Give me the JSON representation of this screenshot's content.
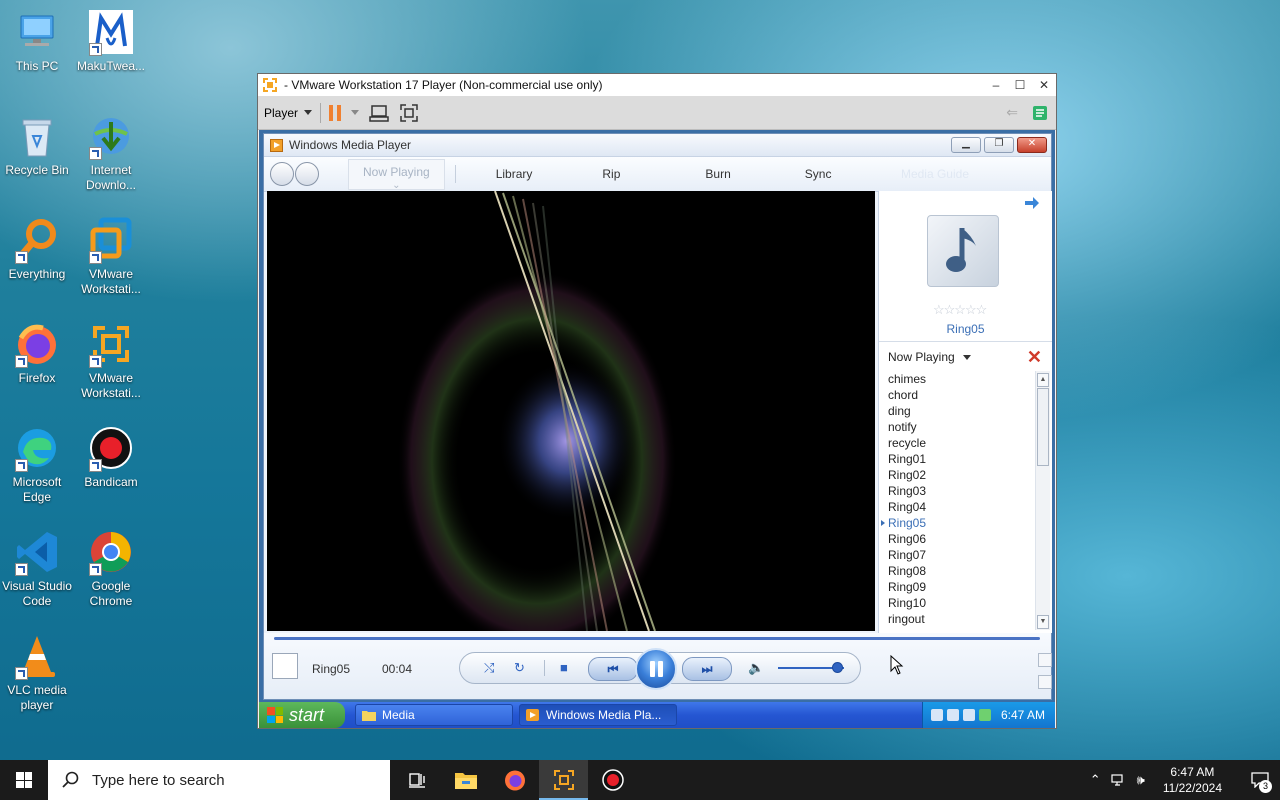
{
  "desktop": {
    "icons": [
      {
        "label": "This PC",
        "icon": "this-pc-icon"
      },
      {
        "label": "MakuTwea...",
        "icon": "makutweaker-icon"
      },
      {
        "label": "Recycle Bin",
        "icon": "recycle-bin-icon"
      },
      {
        "label": "Internet Downlo...",
        "icon": "internet-download-manager-icon"
      },
      {
        "label": "Everything",
        "icon": "everything-search-icon"
      },
      {
        "label": "VMware Workstati...",
        "icon": "vmware-workstation-icon"
      },
      {
        "label": "Firefox",
        "icon": "firefox-icon"
      },
      {
        "label": "VMware Workstati...",
        "icon": "vmware-workstation-player-icon"
      },
      {
        "label": "Microsoft Edge",
        "icon": "edge-icon"
      },
      {
        "label": "Bandicam",
        "icon": "bandicam-icon"
      },
      {
        "label": "Visual Studio Code",
        "icon": "vscode-icon"
      },
      {
        "label": "Google Chrome",
        "icon": "chrome-icon"
      },
      {
        "label": "VLC media player",
        "icon": "vlc-icon"
      }
    ]
  },
  "vmware": {
    "title": "- VMware Workstation 17 Player (Non-commercial use only)",
    "player_menu": "Player",
    "controls": {
      "minimize": "–",
      "maximize": "☐",
      "close": "✕"
    }
  },
  "wmp": {
    "title": "Windows Media Player",
    "tabs": [
      "Now Playing",
      "Library",
      "Rip",
      "Burn",
      "Sync",
      "Media Guide"
    ],
    "current_title": "Ring05",
    "time": "00:04",
    "now_playing_label": "Now Playing",
    "playlist": [
      "chimes",
      "chord",
      "ding",
      "notify",
      "recycle",
      "Ring01",
      "Ring02",
      "Ring03",
      "Ring04",
      "Ring05",
      "Ring06",
      "Ring07",
      "Ring08",
      "Ring09",
      "Ring10",
      "ringout"
    ],
    "current_index": 9,
    "rating_stars": "☆☆☆☆☆",
    "volume": 0.9
  },
  "xp_taskbar": {
    "start": "start",
    "tasks": [
      "Media",
      "Windows Media Pla..."
    ],
    "clock": "6:47 AM"
  },
  "taskbar": {
    "search_placeholder": "Type here to search",
    "time": "6:47 AM",
    "date": "11/22/2024",
    "notification_count": "3"
  }
}
